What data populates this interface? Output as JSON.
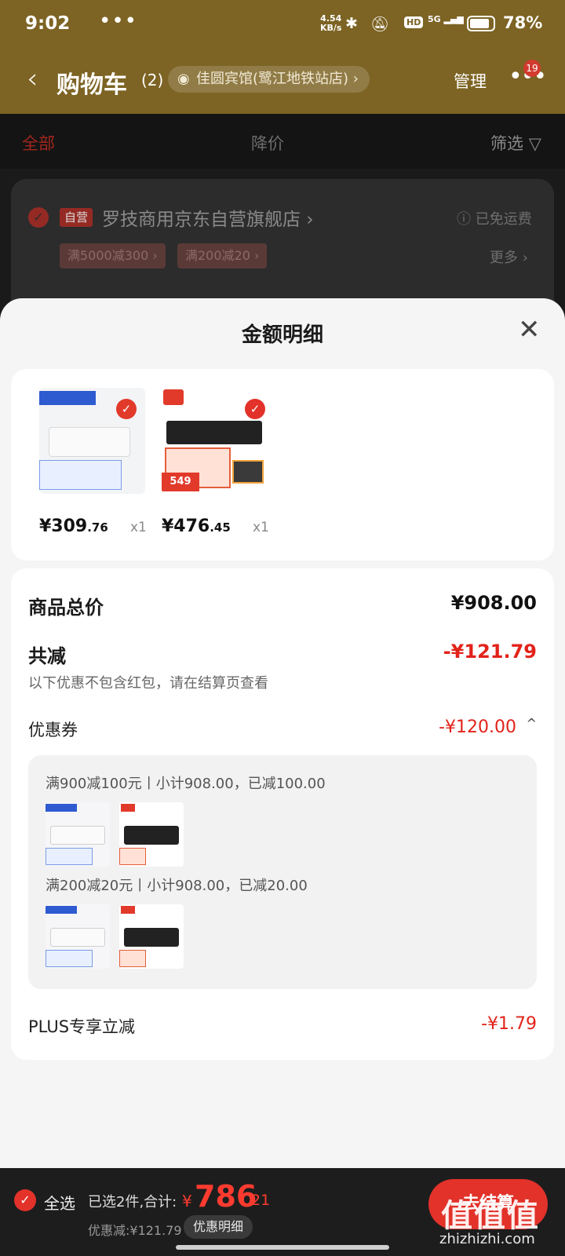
{
  "status": {
    "time": "9:02",
    "dots": "•••",
    "net_speed": "4.54",
    "net_unit": "KB/s",
    "hd": "HD",
    "signal": "5G",
    "battery": "78%"
  },
  "header": {
    "back": "‹",
    "title": "购物车",
    "count": "(2)",
    "address": "佳圆宾馆(鹭江地铁站店)",
    "address_chevron": "›",
    "manage": "管理",
    "more": "•••",
    "badge": "19"
  },
  "tabs": {
    "all": "全部",
    "price_drop": "降价",
    "filter": "筛选"
  },
  "store": {
    "self_tag": "自营",
    "name": "罗技商用京东自营旗舰店",
    "name_chevron": "›",
    "shipping": "ⓘ 已免运费",
    "promo1": "满5000减300 ›",
    "promo2": "满200减20 ›",
    "more": "更多 ›"
  },
  "sheet": {
    "title": "金额明细",
    "close": "✕",
    "products": [
      {
        "price_int": "¥309",
        "price_dec": ".76",
        "qty": "x1"
      },
      {
        "price_int": "¥476",
        "price_dec": ".45",
        "qty": "x1",
        "tag": "549"
      }
    ],
    "summary": {
      "total_label": "商品总价",
      "total_value": "¥908.00",
      "discount_label": "共减",
      "discount_value": "-¥121.79",
      "note": "以下优惠不包含红包，请在结算页查看",
      "coupon_label": "优惠券",
      "coupon_value": "-¥120.00",
      "coupon_caret": "^",
      "coupon_lines": [
        "满900减100元丨小计908.00，已减100.00",
        "满200减20元丨小计908.00，已减20.00"
      ],
      "plus_label": "PLUS专享立减",
      "plus_value": "-¥1.79"
    }
  },
  "bottom": {
    "select_all": "全选",
    "selected": "已选2件,合计:",
    "yen": "¥",
    "total_int": "786",
    "total_dec": ".21",
    "discount": "优惠减:¥121.79",
    "detail_button": "优惠明细",
    "checkout": "去结算"
  },
  "watermark": {
    "main": "值值值",
    "url": "zhizhizhi.com"
  },
  "colors": {
    "accent": "#e2322a",
    "header_bg": "#7d6424",
    "sheet_bg": "#f5f5f5"
  }
}
